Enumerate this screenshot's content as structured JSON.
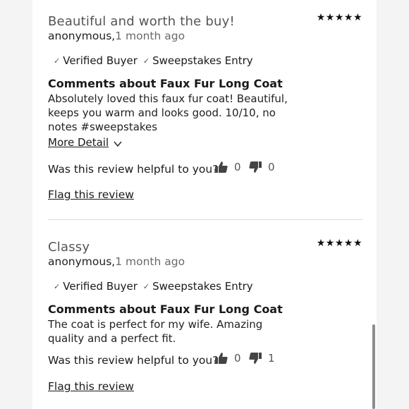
{
  "reviews": [
    {
      "title": "Beautiful and worth the buy!",
      "stars": "★★★★★",
      "rating": 5,
      "author": "anonymous,",
      "date": "1 month ago",
      "badges": [
        "Verified Buyer",
        "Sweepstakes Entry"
      ],
      "heading": "Comments about Faux Fur Long Coat",
      "body": "Absolutely loved this faux fur coat! Beautiful, keeps you warm and looks good. 10/10, no notes #sweepstakes",
      "more_label": "More Detail",
      "helpful_prompt": "Was this review helpful to you?",
      "upvotes": "0",
      "downvotes": "0",
      "flag_label": "Flag this review"
    },
    {
      "title": "Classy",
      "stars": "★★★★★",
      "rating": 5,
      "author": "anonymous,",
      "date": "1 month ago",
      "badges": [
        "Verified Buyer",
        "Sweepstakes Entry"
      ],
      "heading": "Comments about Faux Fur Long Coat",
      "body": "The coat is perfect for my wife. Amazing quality and a perfect fit.",
      "helpful_prompt": "Was this review helpful to you?",
      "upvotes": "0",
      "downvotes": "1",
      "flag_label": "Flag this review"
    }
  ],
  "icons": {
    "check": "check-icon",
    "thumbs_up": "thumbs-up-icon",
    "thumbs_down": "thumbs-down-icon",
    "chevron": "chevron-down-icon"
  }
}
